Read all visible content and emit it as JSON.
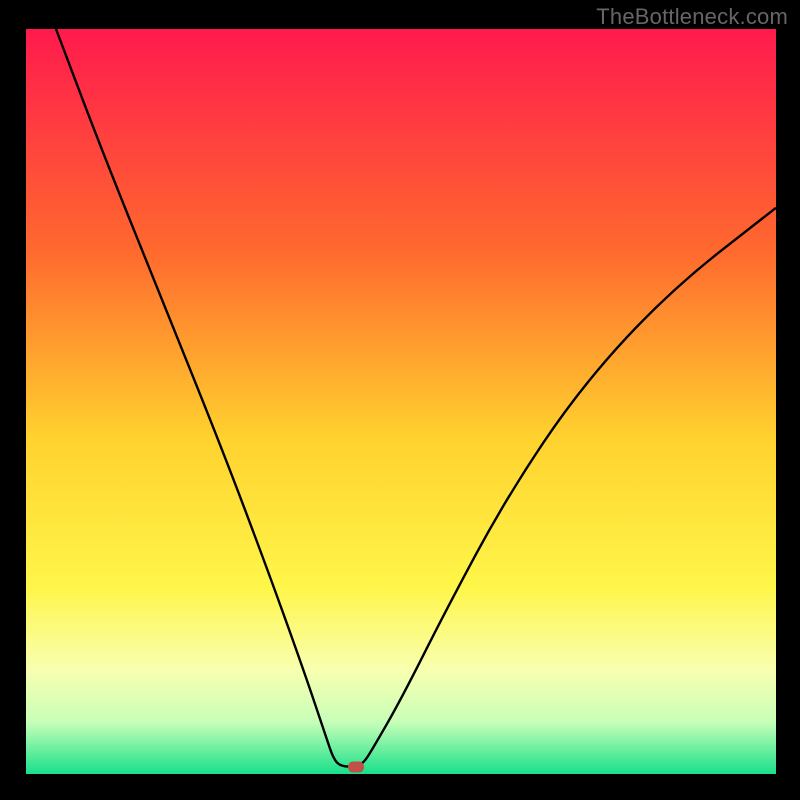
{
  "watermark": "TheBottleneck.com",
  "chart_data": {
    "type": "line",
    "title": "",
    "xlabel": "",
    "ylabel": "",
    "xlim": [
      0,
      100
    ],
    "ylim": [
      0,
      100
    ],
    "background_gradient": {
      "stops": [
        {
          "offset": 0,
          "color": "#ff1a4d"
        },
        {
          "offset": 30,
          "color": "#ff6a2e"
        },
        {
          "offset": 55,
          "color": "#ffd22e"
        },
        {
          "offset": 75,
          "color": "#fff64a"
        },
        {
          "offset": 86,
          "color": "#f8ffb0"
        },
        {
          "offset": 93,
          "color": "#c8ffb8"
        },
        {
          "offset": 100,
          "color": "#18e08a"
        }
      ]
    },
    "curve": {
      "description": "V-shaped bottleneck curve; minimum near x≈43",
      "points": [
        {
          "x": 4,
          "y": 100
        },
        {
          "x": 10,
          "y": 84
        },
        {
          "x": 18,
          "y": 64
        },
        {
          "x": 26,
          "y": 44
        },
        {
          "x": 32,
          "y": 28
        },
        {
          "x": 37,
          "y": 14
        },
        {
          "x": 40,
          "y": 5
        },
        {
          "x": 41,
          "y": 2
        },
        {
          "x": 42,
          "y": 1
        },
        {
          "x": 44,
          "y": 1
        },
        {
          "x": 45,
          "y": 1.5
        },
        {
          "x": 46,
          "y": 3
        },
        {
          "x": 50,
          "y": 10
        },
        {
          "x": 56,
          "y": 22
        },
        {
          "x": 64,
          "y": 37
        },
        {
          "x": 74,
          "y": 52
        },
        {
          "x": 86,
          "y": 65
        },
        {
          "x": 100,
          "y": 76
        }
      ]
    },
    "marker": {
      "x": 44,
      "y": 1,
      "color": "#c05048"
    }
  }
}
